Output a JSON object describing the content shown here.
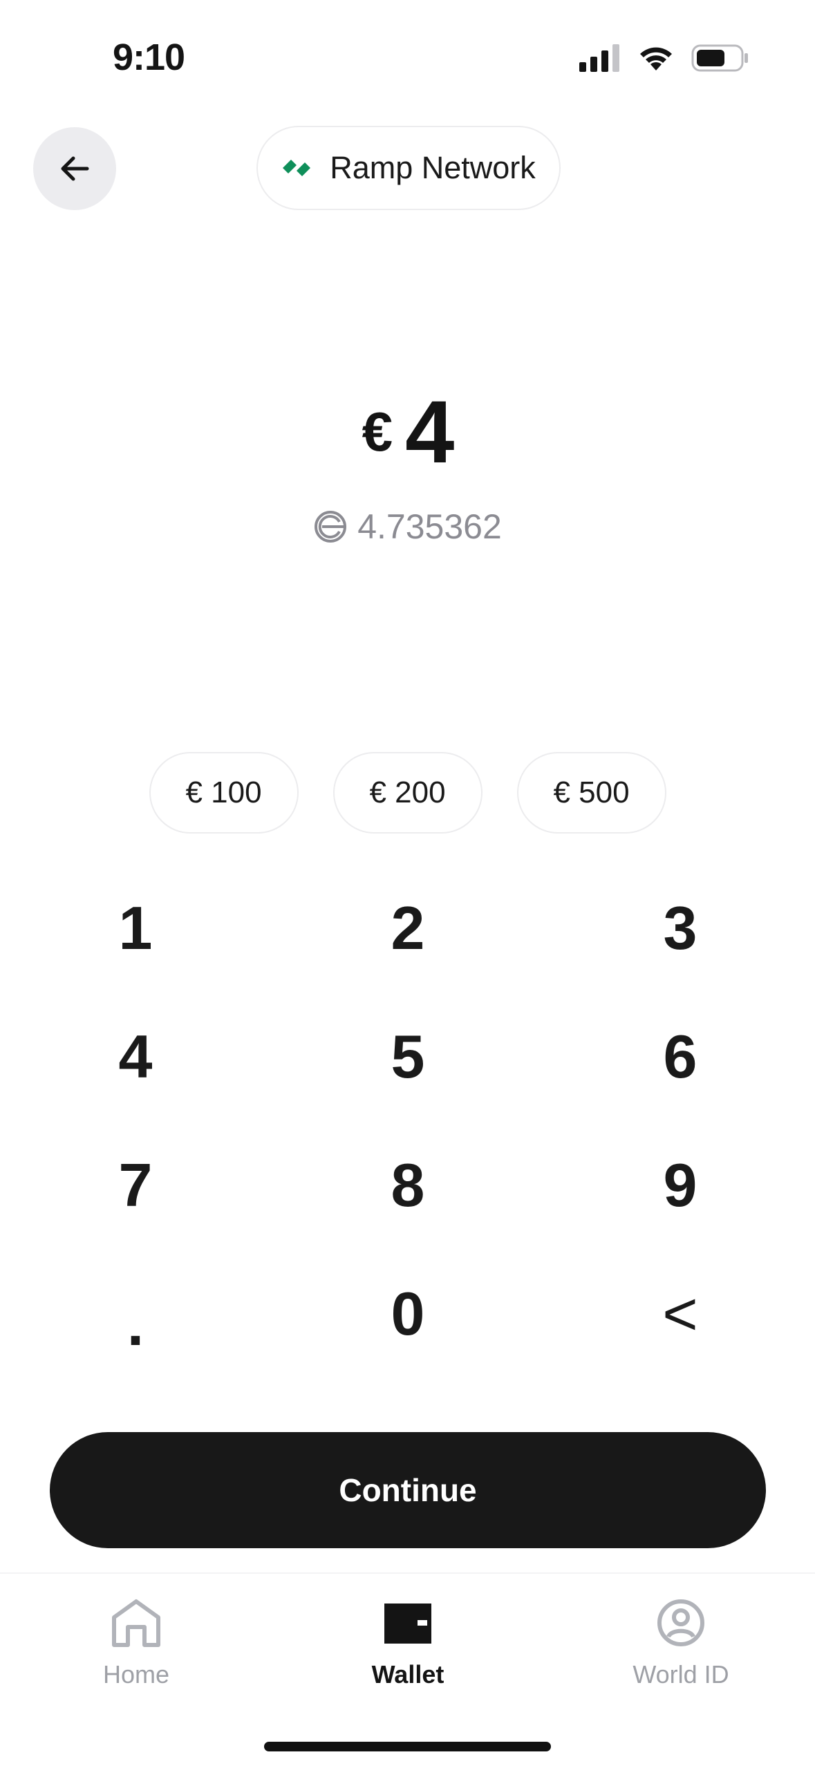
{
  "status_bar": {
    "time": "9:10",
    "icons": [
      "cellular-signal-icon",
      "wifi-icon",
      "battery-icon"
    ]
  },
  "header": {
    "back_icon": "arrow-left-icon",
    "provider_name": "Ramp Network",
    "provider_logo": "ramp-logo-icon",
    "logo_color": "#0F8F5A"
  },
  "amount": {
    "currency_symbol": "€",
    "value": "4",
    "crypto_icon": "worldcoin-icon",
    "crypto_value": "4.735362"
  },
  "presets": [
    {
      "label": "€ 100"
    },
    {
      "label": "€ 200"
    },
    {
      "label": "€ 500"
    }
  ],
  "keypad": {
    "keys": [
      "1",
      "2",
      "3",
      "4",
      "5",
      "6",
      "7",
      "8",
      "9",
      ".",
      "0",
      "<"
    ]
  },
  "continue_label": "Continue",
  "tab_bar": {
    "items": [
      {
        "label": "Home",
        "icon": "home-icon",
        "active": false
      },
      {
        "label": "Wallet",
        "icon": "wallet-icon",
        "active": true
      },
      {
        "label": "World ID",
        "icon": "user-circle-icon",
        "active": false
      }
    ]
  },
  "colors": {
    "accent_dark": "#181818",
    "muted_text": "#8B8B92",
    "brand_green": "#0F8F5A"
  }
}
